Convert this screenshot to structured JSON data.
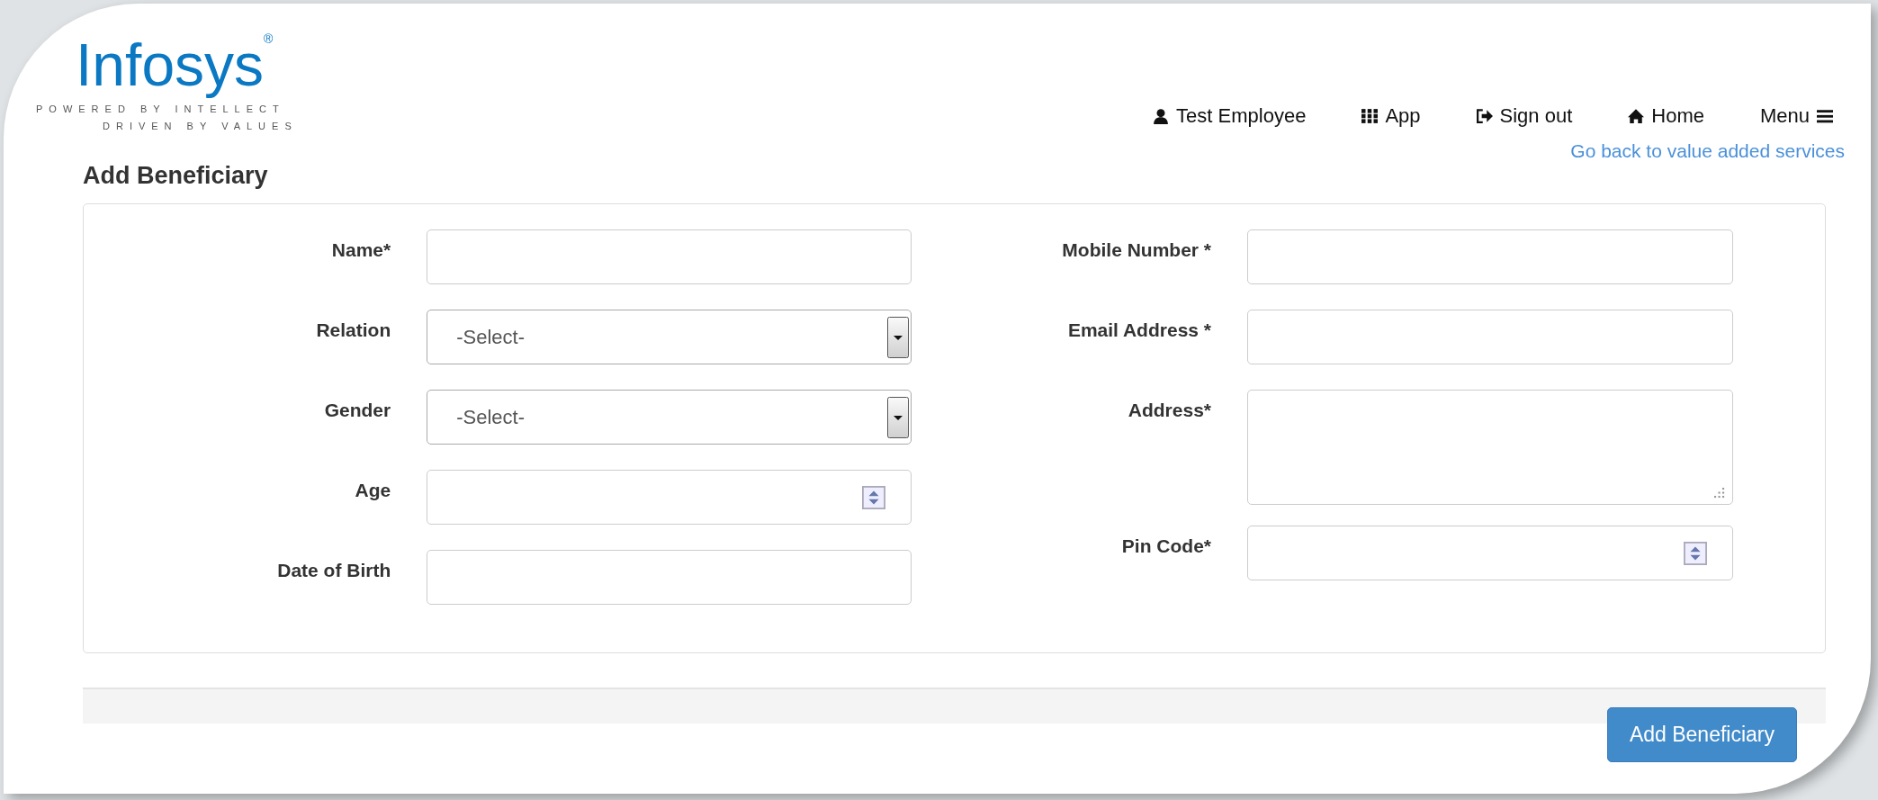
{
  "logo": {
    "wordmark": "Infosys",
    "registered": "®",
    "tagline": [
      "POWERED BY INTELLECT",
      "DRIVEN BY VALUES"
    ]
  },
  "nav": [
    {
      "label": "Test Employee",
      "kind": "user"
    },
    {
      "label": "App",
      "kind": "grid"
    },
    {
      "label": "Sign out",
      "kind": "signout"
    },
    {
      "label": "Home",
      "kind": "home"
    },
    {
      "label": "Menu",
      "kind": "menu"
    }
  ],
  "back_link": "Go back to value added services",
  "title": "Add Beneficiary",
  "form": {
    "left": [
      {
        "label": "Name*",
        "kind": "text"
      },
      {
        "label": "Relation",
        "kind": "select",
        "value": "-Select-"
      },
      {
        "label": "Gender",
        "kind": "select",
        "value": "-Select-"
      },
      {
        "label": "Age",
        "kind": "number"
      },
      {
        "label": "Date of Birth",
        "kind": "text"
      }
    ],
    "right": [
      {
        "label": "Mobile Number *",
        "kind": "text"
      },
      {
        "label": "Email Address *",
        "kind": "text"
      },
      {
        "label": "Address*",
        "kind": "textarea"
      },
      {
        "label": "Pin Code*",
        "kind": "number"
      }
    ]
  },
  "submit": "Add Beneficiary"
}
